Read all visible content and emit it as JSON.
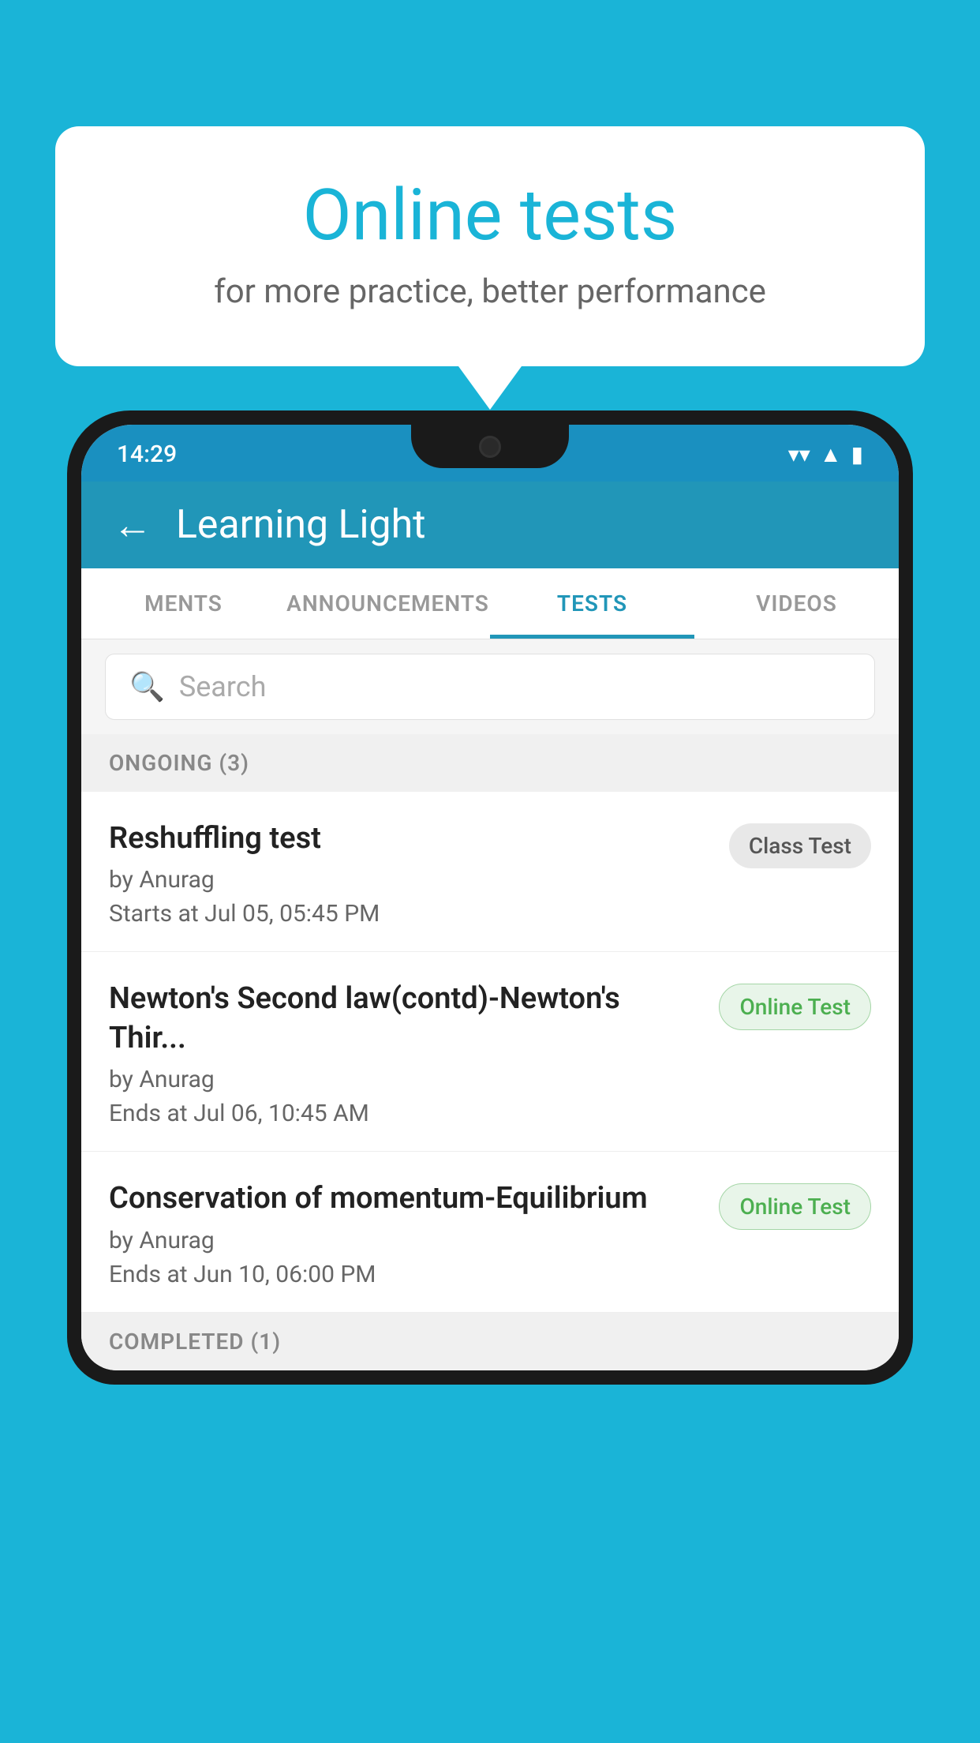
{
  "background_color": "#1ab4d7",
  "bubble": {
    "title": "Online tests",
    "subtitle": "for more practice, better performance"
  },
  "phone": {
    "status_bar": {
      "time": "14:29",
      "wifi": "▼",
      "signal": "▲",
      "battery": "▮"
    },
    "header": {
      "back_label": "←",
      "title": "Learning Light"
    },
    "tabs": [
      {
        "label": "MENTS",
        "active": false
      },
      {
        "label": "ANNOUNCEMENTS",
        "active": false
      },
      {
        "label": "TESTS",
        "active": true
      },
      {
        "label": "VIDEOS",
        "active": false
      }
    ],
    "search": {
      "placeholder": "Search"
    },
    "ongoing_section": {
      "label": "ONGOING (3)"
    },
    "tests": [
      {
        "name": "Reshuffling test",
        "author": "by Anurag",
        "time_label": "Starts at",
        "time": "Jul 05, 05:45 PM",
        "badge": "Class Test",
        "badge_type": "class"
      },
      {
        "name": "Newton's Second law(contd)-Newton's Thir...",
        "author": "by Anurag",
        "time_label": "Ends at",
        "time": "Jul 06, 10:45 AM",
        "badge": "Online Test",
        "badge_type": "online"
      },
      {
        "name": "Conservation of momentum-Equilibrium",
        "author": "by Anurag",
        "time_label": "Ends at",
        "time": "Jun 10, 06:00 PM",
        "badge": "Online Test",
        "badge_type": "online"
      }
    ],
    "completed_section": {
      "label": "COMPLETED (1)"
    }
  }
}
